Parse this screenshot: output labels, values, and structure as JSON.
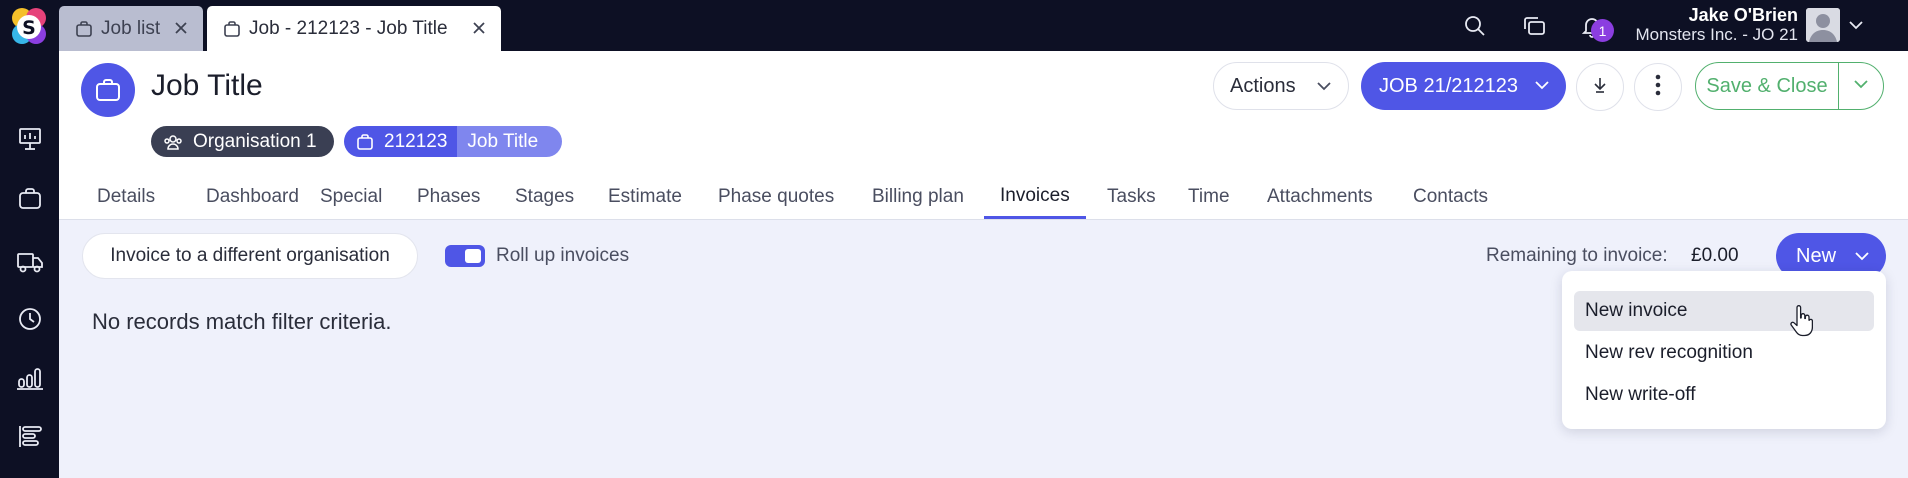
{
  "tabs": [
    {
      "label": "Job list",
      "active": false
    },
    {
      "label": "Job - 212123 - Job Title",
      "active": true
    }
  ],
  "topbar": {
    "notification_count": "1",
    "user_name": "Jake O'Brien",
    "user_org": "Monsters Inc. - JO 21"
  },
  "rail_icons": [
    "dashboard-board-icon",
    "briefcase-icon",
    "truck-icon",
    "clock-icon",
    "bar-chart-icon",
    "gantt-icon"
  ],
  "header": {
    "title": "Job Title",
    "org_chip": "Organisation 1",
    "job_chip_number": "212123",
    "job_chip_title": "Job Title",
    "actions_label": "Actions",
    "job_button_label": "JOB 21/212123",
    "save_close_label": "Save & Close"
  },
  "nav": [
    {
      "label": "Details",
      "active": false
    },
    {
      "label": "Dashboard",
      "active": false
    },
    {
      "label": "Special",
      "active": false
    },
    {
      "label": "Phases",
      "active": false
    },
    {
      "label": "Stages",
      "active": false
    },
    {
      "label": "Estimate",
      "active": false
    },
    {
      "label": "Phase quotes",
      "active": false
    },
    {
      "label": "Billing plan",
      "active": false
    },
    {
      "label": "Invoices",
      "active": true
    },
    {
      "label": "Tasks",
      "active": false
    },
    {
      "label": "Time",
      "active": false
    },
    {
      "label": "Attachments",
      "active": false
    },
    {
      "label": "Contacts",
      "active": false
    }
  ],
  "invoices": {
    "different_org_label": "Invoice to a different organisation",
    "rollup_label": "Roll up invoices",
    "rollup_on": true,
    "remaining_label": "Remaining to invoice:",
    "remaining_value": "£0.00",
    "new_label": "New",
    "empty_message": "No records match filter criteria."
  },
  "new_menu": [
    {
      "label": "New invoice",
      "hovered": true
    },
    {
      "label": "New rev recognition",
      "hovered": false
    },
    {
      "label": "New write-off",
      "hovered": false
    }
  ],
  "colors": {
    "accent": "#4f56e6",
    "dark": "#0d1024",
    "save_green": "#52b06e",
    "badge": "#8b3ee0"
  }
}
